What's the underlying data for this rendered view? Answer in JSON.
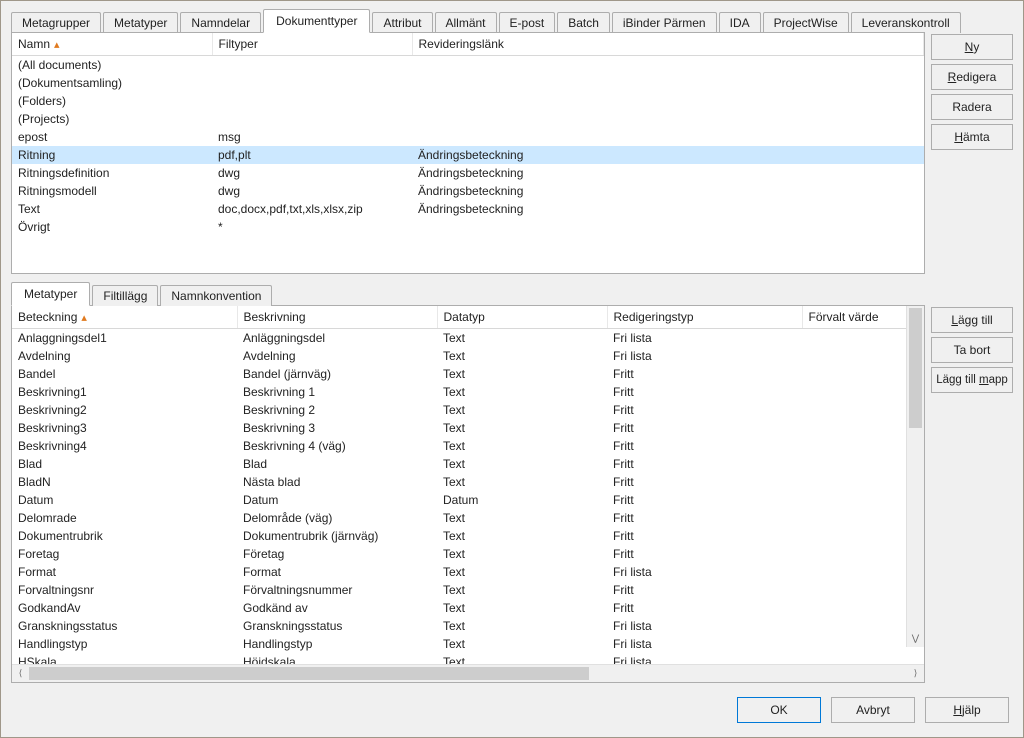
{
  "topTabs": [
    "Metagrupper",
    "Metatyper",
    "Namndelar",
    "Dokumenttyper",
    "Attribut",
    "Allmänt",
    "E-post",
    "Batch",
    "iBinder Pärmen",
    "IDA",
    "ProjectWise",
    "Leveranskontroll"
  ],
  "topActive": 3,
  "topColumns": {
    "namn": "Namn",
    "filtyper": "Filtyper",
    "rev": "Revideringslänk"
  },
  "topSortCol": "namn",
  "topSelected": 4,
  "topRows": [
    {
      "namn": "(All documents)",
      "filtyper": "",
      "rev": ""
    },
    {
      "namn": "(Dokumentsamling)",
      "filtyper": "",
      "rev": ""
    },
    {
      "namn": "(Folders)",
      "filtyper": "",
      "rev": ""
    },
    {
      "namn": "(Projects)",
      "filtyper": "",
      "rev": ""
    },
    {
      "namn": "epost",
      "filtyper": "msg",
      "rev": ""
    },
    {
      "namn": "Ritning",
      "filtyper": "pdf,plt",
      "rev": "Ändringsbeteckning"
    },
    {
      "namn": "Ritningsdefinition",
      "filtyper": "dwg",
      "rev": "Ändringsbeteckning"
    },
    {
      "namn": "Ritningsmodell",
      "filtyper": "dwg",
      "rev": "Ändringsbeteckning"
    },
    {
      "namn": "Text",
      "filtyper": "doc,docx,pdf,txt,xls,xlsx,zip",
      "rev": "Ändringsbeteckning"
    },
    {
      "namn": "Övrigt",
      "filtyper": "*",
      "rev": ""
    }
  ],
  "sideBtnsTop": {
    "ny": "Ny",
    "redigera": "Redigera",
    "radera": "Radera",
    "hamta": "Hämta"
  },
  "subTabs": [
    "Metatyper",
    "Filtillägg",
    "Namnkonvention"
  ],
  "subActive": 0,
  "botColumns": {
    "bet": "Beteckning",
    "besk": "Beskrivning",
    "dt": "Datatyp",
    "red": "Redigeringstyp",
    "def": "Förvalt värde"
  },
  "botSortCol": "bet",
  "botRows": [
    {
      "bet": "Anlaggningsdel1",
      "besk": "Anläggningsdel",
      "dt": "Text",
      "red": "Fri lista",
      "def": ""
    },
    {
      "bet": "Avdelning",
      "besk": "Avdelning",
      "dt": "Text",
      "red": "Fri lista",
      "def": ""
    },
    {
      "bet": "Bandel",
      "besk": "Bandel (järnväg)",
      "dt": "Text",
      "red": "Fritt",
      "def": ""
    },
    {
      "bet": "Beskrivning1",
      "besk": "Beskrivning 1",
      "dt": "Text",
      "red": "Fritt",
      "def": ""
    },
    {
      "bet": "Beskrivning2",
      "besk": "Beskrivning 2",
      "dt": "Text",
      "red": "Fritt",
      "def": ""
    },
    {
      "bet": "Beskrivning3",
      "besk": "Beskrivning 3",
      "dt": "Text",
      "red": "Fritt",
      "def": ""
    },
    {
      "bet": "Beskrivning4",
      "besk": "Beskrivning 4 (väg)",
      "dt": "Text",
      "red": "Fritt",
      "def": ""
    },
    {
      "bet": "Blad",
      "besk": "Blad",
      "dt": "Text",
      "red": "Fritt",
      "def": ""
    },
    {
      "bet": "BladN",
      "besk": "Nästa blad",
      "dt": "Text",
      "red": "Fritt",
      "def": ""
    },
    {
      "bet": "Datum",
      "besk": "Datum",
      "dt": "Datum",
      "red": "Fritt",
      "def": ""
    },
    {
      "bet": "Delomrade",
      "besk": "Delområde (väg)",
      "dt": "Text",
      "red": "Fritt",
      "def": ""
    },
    {
      "bet": "Dokumentrubrik",
      "besk": "Dokumentrubrik (järnväg)",
      "dt": "Text",
      "red": "Fritt",
      "def": ""
    },
    {
      "bet": "Foretag",
      "besk": "Företag",
      "dt": "Text",
      "red": "Fritt",
      "def": ""
    },
    {
      "bet": "Format",
      "besk": "Format",
      "dt": "Text",
      "red": "Fri lista",
      "def": ""
    },
    {
      "bet": "Forvaltningsnr",
      "besk": "Förvaltningsnummer",
      "dt": "Text",
      "red": "Fritt",
      "def": ""
    },
    {
      "bet": "GodkandAv",
      "besk": "Godkänd av",
      "dt": "Text",
      "red": "Fritt",
      "def": ""
    },
    {
      "bet": "Granskningsstatus",
      "besk": "Granskningsstatus",
      "dt": "Text",
      "red": "Fri lista",
      "def": ""
    },
    {
      "bet": "Handlingstyp",
      "besk": "Handlingstyp",
      "dt": "Text",
      "red": "Fri lista",
      "def": ""
    },
    {
      "bet": "HSkala",
      "besk": "Höjdskala",
      "dt": "Text",
      "red": "Fri lista",
      "def": ""
    }
  ],
  "sideBtnsBot": {
    "lagg": "Lägg till",
    "tabort": "Ta bort",
    "mapp": "Lägg till mapp"
  },
  "footer": {
    "ok": "OK",
    "avbryt": "Avbryt",
    "hjalp": "Hjälp"
  }
}
